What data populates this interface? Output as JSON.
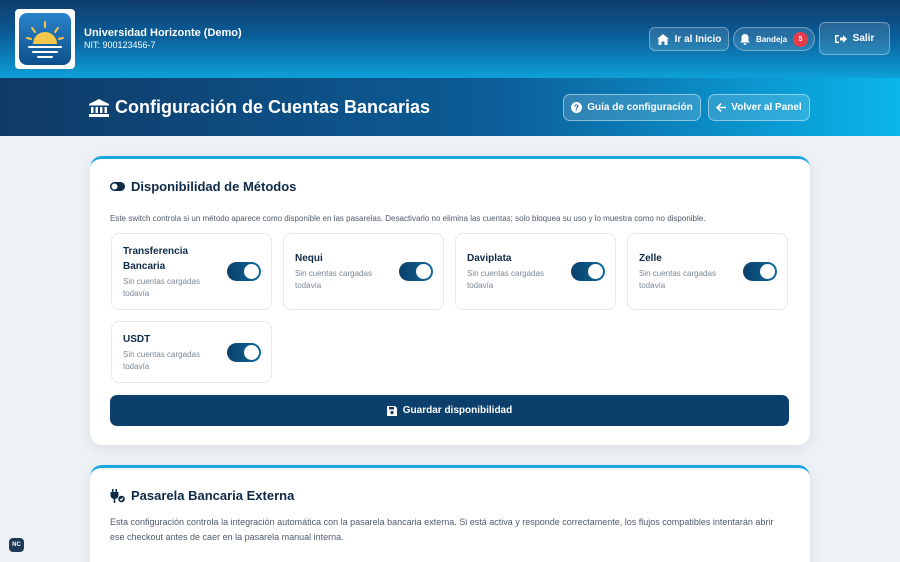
{
  "header": {
    "org_name": "Universidad Horizonte (Demo)",
    "org_nit": "NIT: 900123456-7",
    "home_label": "Ir al Inicio",
    "inbox_label": "Bandeja",
    "inbox_count": "5",
    "exit_label": "Salir"
  },
  "titlebar": {
    "title": "Configuración de Cuentas Bancarias",
    "guide_label": "Guía de configuración",
    "back_label": "Volver al Panel"
  },
  "availability": {
    "title": "Disponibilidad de Métodos",
    "description": "Este switch controla si un método aparece como disponible en las pasarelas. Desactivarlo no elimina las cuentas; solo bloquea su uso y lo muestra como no disponible.",
    "methods": [
      {
        "name_line1": "Transferencia",
        "name_line2": "Bancaria",
        "status_line1": "Sin cuentas cargadas",
        "status_line2": "todavía",
        "enabled": true
      },
      {
        "name_line1": "Nequi",
        "status_line1": "Sin cuentas cargadas",
        "status_line2": "todavía",
        "enabled": true
      },
      {
        "name_line1": "Daviplata",
        "status_line1": "Sin cuentas cargadas",
        "status_line2": "todavía",
        "enabled": true
      },
      {
        "name_line1": "Zelle",
        "status_line1": "Sin cuentas cargadas",
        "status_line2": "todavía",
        "enabled": true
      },
      {
        "name_line1": "USDT",
        "status_line1": "Sin cuentas cargadas",
        "status_line2": "todavía",
        "enabled": true
      }
    ],
    "save_label": "Guardar disponibilidad"
  },
  "gateway": {
    "title": "Pasarela Bancaria Externa",
    "description_line1": "Esta configuración controla la integración automática con la pasarela bancaria externa. Si está activa y responde correctamente, los flujos compatibles intentarán abrir",
    "description_line2": "ese checkout antes de caer en la pasarela manual interna."
  },
  "corner_badge": "NC",
  "colors": {
    "accent": "#1aa7e1",
    "primary_dark": "#0c3f6c",
    "badge_red": "#e53b4a"
  }
}
